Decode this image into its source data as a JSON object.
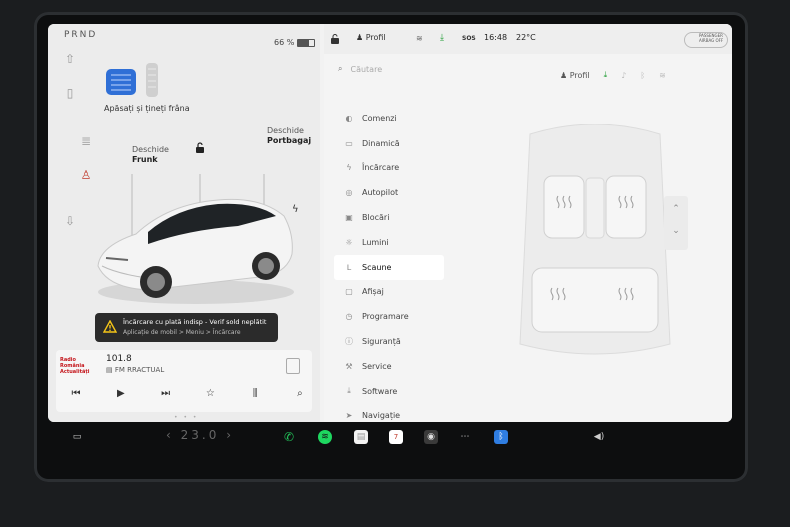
{
  "left_panel": {
    "gear": "PRND",
    "battery": {
      "percent_text": "66 %",
      "level": 0.66
    },
    "brake_prompt": "Apăsați și țineți frâna",
    "frunk": {
      "line1": "Deschide",
      "line2": "Frunk"
    },
    "trunk": {
      "line1": "Deschide",
      "line2": "Portbagaj"
    },
    "alert": {
      "title": "Încărcare cu plată indisp - Verif sold neplătit",
      "subtitle": "Aplicație de mobil > Meniu > Încărcare"
    },
    "media": {
      "frequency": "101.8",
      "station": "FM RRACTUAL",
      "logo_text": "Radio România Actualități"
    }
  },
  "top_bar": {
    "profile": "Profil",
    "time": "16:48",
    "temperature": "22°C",
    "sos": "SOS",
    "airbag": "PASSENGER AIRBAG OFF"
  },
  "right_panel": {
    "search_placeholder": "Căutare",
    "profile": "Profil",
    "menu": [
      {
        "label": "Comenzi",
        "icon": "toggle-icon",
        "glyph": "◐"
      },
      {
        "label": "Dinamică",
        "icon": "car-icon",
        "glyph": "▭"
      },
      {
        "label": "Încărcare",
        "icon": "bolt-icon",
        "glyph": "ϟ"
      },
      {
        "label": "Autopilot",
        "icon": "steering-icon",
        "glyph": "◎"
      },
      {
        "label": "Blocări",
        "icon": "lock-icon",
        "glyph": "▣"
      },
      {
        "label": "Lumini",
        "icon": "sun-icon",
        "glyph": "☼"
      },
      {
        "label": "Scaune",
        "icon": "seat-icon",
        "glyph": "ᒪ"
      },
      {
        "label": "Afișaj",
        "icon": "display-icon",
        "glyph": "▢"
      },
      {
        "label": "Programare",
        "icon": "clock-icon",
        "glyph": "◷"
      },
      {
        "label": "Siguranță",
        "icon": "shield-icon",
        "glyph": "ⓘ"
      },
      {
        "label": "Service",
        "icon": "wrench-icon",
        "glyph": "⚒"
      },
      {
        "label": "Software",
        "icon": "download-icon",
        "glyph": "⤓"
      },
      {
        "label": "Navigație",
        "icon": "navigation-icon",
        "glyph": "➤"
      }
    ],
    "active_menu": "Scaune"
  },
  "dock": {
    "cabin_temp": "23.0"
  },
  "colors": {
    "accent_green": "#1a9b2f",
    "brake_blue": "#2f6fd6",
    "alert_bg": "#2b2b2b"
  }
}
